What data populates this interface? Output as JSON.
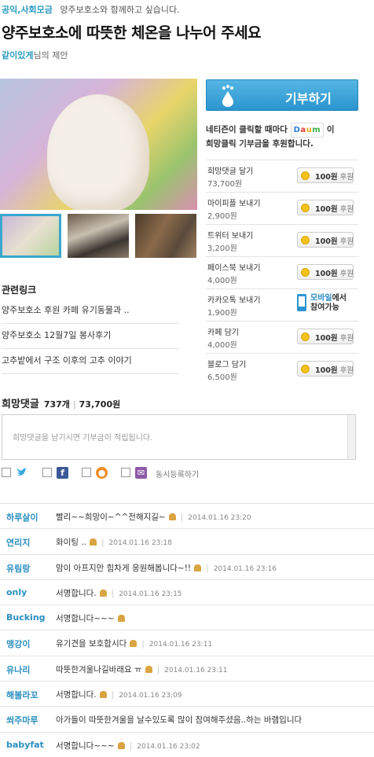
{
  "header": {
    "category": "공익,사회모금",
    "subtitle": "양주보호소와 함께하고 싶습니다.",
    "title": "양주보호소에 따뜻한 체온을 나누어 주세요",
    "proposer_nick": "같이있게",
    "proposer_suffix": "님의 제안"
  },
  "links": {
    "title": "관련링크",
    "items": [
      "양주보호소 후원 카페 유기동물과 ..",
      "양주보호소 12월7일 봉사후기",
      "고추밭에서 구조 이후의 고추 이야기"
    ]
  },
  "donate": {
    "button_label": "기부하기",
    "sponsor_line1_a": "네티즌이 클릭할 때마다",
    "sponsor_line1_b": "이",
    "sponsor_brand": "Daum",
    "sponsor_line2": "희망클릭 기부금을 후원합니다.",
    "rows": [
      {
        "label": "희망댓글 달기",
        "amount": "73,700원",
        "pill": "100원",
        "unit": "후원"
      },
      {
        "label": "마이피플 보내기",
        "amount": "2,900원",
        "pill": "100원",
        "unit": "후원"
      },
      {
        "label": "트위터 보내기",
        "amount": "3,200원",
        "pill": "100원",
        "unit": "후원"
      },
      {
        "label": "페이스북 보내기",
        "amount": "4,000원",
        "pill": "100원",
        "unit": "후원"
      },
      {
        "label": "카카오톡 보내기",
        "amount": "1,900원",
        "mobile_a": "모바일",
        "mobile_b": "에서",
        "mobile_c": "참여가능"
      },
      {
        "label": "카페 담기",
        "amount": "4,000원",
        "pill": "100원",
        "unit": "후원"
      },
      {
        "label": "블로그 담기",
        "amount": "6,500원",
        "pill": "100원",
        "unit": "후원"
      }
    ]
  },
  "comments_header": {
    "title": "희망댓글",
    "count": "737개",
    "total": "73,700원",
    "placeholder": "희망댓글을 남기시면 기부금이 적립됩니다.",
    "share_label": "동시등록하기"
  },
  "comments": [
    {
      "nick": "하루살이",
      "text": "빨리~~희망이~^^전해지길~",
      "time": "2014.01.16 23:20"
    },
    {
      "nick": "연리지",
      "text": "화이팅 ..",
      "time": "2014.01.16 23:18"
    },
    {
      "nick": "유림랑",
      "text": "맘이 아프지만 힘차게 응원해봅니다~!!",
      "time": "2014.01.16 23:16"
    },
    {
      "nick": "only",
      "text": "서명합니다.",
      "time": "2014.01.16 23:15"
    },
    {
      "nick": "Bucking",
      "text": "서명합니다~~~",
      "time": ""
    },
    {
      "nick": "맹강이",
      "text": "유기견을 보호합시다",
      "time": "2014.01.16 23:11"
    },
    {
      "nick": "유나리",
      "text": "따뜻한겨울나길바래요 ㅠ",
      "time": "2014.01.16 23:11"
    },
    {
      "nick": "해볼라꼬",
      "text": "서명합니다.",
      "time": "2014.01.16 23:09"
    },
    {
      "nick": "쐬주마루",
      "text": "아가들이 따뜻한겨울을 날수있도록 많이 참여해주셨음..하는 바램입니다",
      "time": ""
    },
    {
      "nick": "babyfat",
      "text": "서명합니다~~~",
      "time": "2014.01.16 23:02"
    }
  ]
}
